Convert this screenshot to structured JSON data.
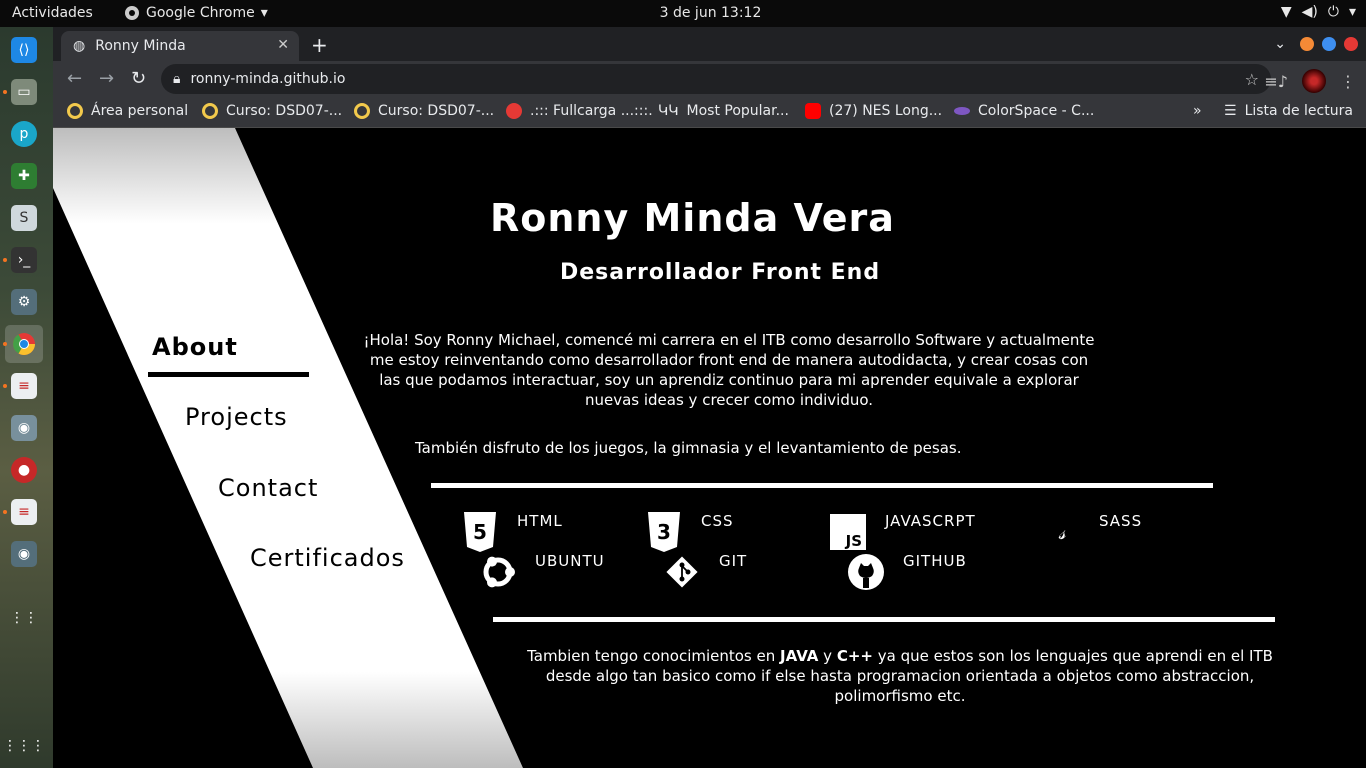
{
  "topbar": {
    "activities": "Actividades",
    "app_name": "Google Chrome",
    "clock": "3 de jun  13:12"
  },
  "browser": {
    "tab_title": "Ronny Minda",
    "url": "ronny-minda.github.io",
    "bookmarks": [
      {
        "label": "Área personal",
        "icon": "qualitas-icon",
        "color": "#f2c94c"
      },
      {
        "label": "Curso: DSD07-...",
        "icon": "qualitas-icon",
        "color": "#f2c94c"
      },
      {
        "label": "Curso: DSD07-...",
        "icon": "qualitas-icon",
        "color": "#f2c94c"
      },
      {
        "label": ".::: Fullcarga ...:::.",
        "icon": "fullcarga-icon",
        "color": "#e53935"
      },
      {
        "label": "Most Popular...",
        "icon": "imdb-icon",
        "color": "#e8eaed"
      },
      {
        "label": "(27) NES Long...",
        "icon": "youtube-icon",
        "color": "#ff0000"
      },
      {
        "label": "ColorSpace - C...",
        "icon": "colorspace-icon",
        "color": "#7e57c2"
      }
    ],
    "more_bookmarks": "»",
    "reading_list": "Lista de lectura"
  },
  "page": {
    "nav": {
      "about": "About",
      "projects": "Projects",
      "contact": "Contact",
      "certificates": "Certificados"
    },
    "name": "Ronny Minda Vera",
    "role": "Desarrollador Front End",
    "about_text": "¡Hola! Soy Ronny Michael, comencé mi carrera en el ITB como desarrollo Software y actualmente me estoy reinventando como desarrollador front end de manera autodidacta, y crear cosas con las que podamos interactuar, soy un aprendiz continuo para mi aprender equivale a explorar nuevas ideas y crecer como individuo.",
    "hobbies": "También disfruto de los juegos, la gimnasia y el levantamiento de pesas.",
    "skills": [
      {
        "label": "HTML",
        "icon": "html5-icon"
      },
      {
        "label": "CSS",
        "icon": "css3-icon"
      },
      {
        "label": "JAVASCRPT",
        "icon": "javascript-icon"
      },
      {
        "label": "SASS",
        "icon": "sass-icon"
      },
      {
        "label": "UBUNTU",
        "icon": "ubuntu-icon"
      },
      {
        "label": "GIT",
        "icon": "git-icon"
      },
      {
        "label": "GITHUB",
        "icon": "github-icon"
      }
    ],
    "extra_prefix": "Tambien tengo conocimientos en ",
    "extra_java": "JAVA",
    "extra_and": " y ",
    "extra_cpp": "C++",
    "extra_suffix": " ya que estos son los lenguajes que aprendi en el ITB desde algo tan basico como if else hasta programacion orientada a objetos como abstraccion, polimorfismo etc."
  },
  "colors": {
    "page_bg": "#000000",
    "stripe": "#ffffff",
    "chrome_dark": "#202124",
    "chrome_toolbar": "#35363a"
  }
}
